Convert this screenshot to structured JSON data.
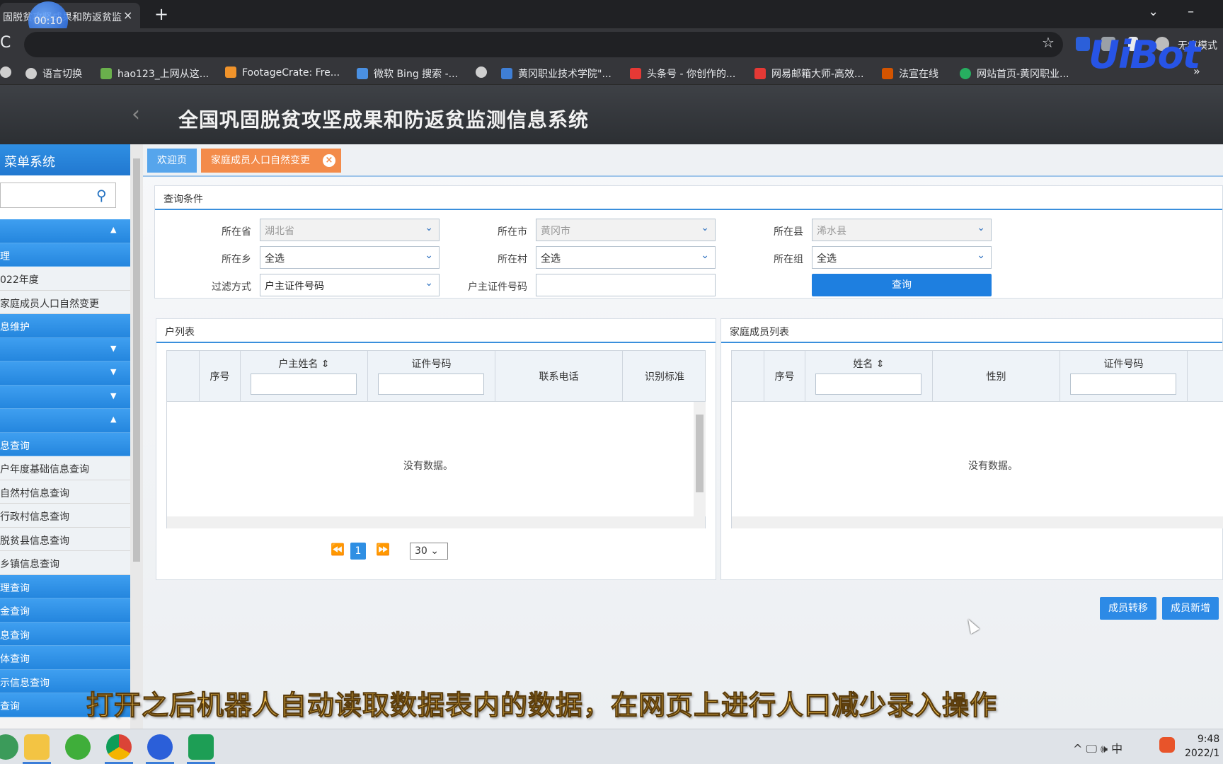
{
  "browser": {
    "tab_title": "固脱贫攻坚成果和防返贫监",
    "recording_time": "00:10",
    "tab_close": "×",
    "new_tab": "+",
    "reload": "C",
    "star": "☆",
    "profile_label": "无痕模式",
    "minimize": "–",
    "dropdown": "⌄",
    "logo_text": "UiBot",
    "bookmarks": [
      {
        "label": "语言切换",
        "color": "#cfcfcf"
      },
      {
        "label": "hao123_上网从这...",
        "color": "#6ab04c"
      },
      {
        "label": "FootageCrate: Fre...",
        "color": "#f0932b"
      },
      {
        "label": "微软 Bing 搜索 -...",
        "color": "#4a90e2"
      },
      {
        "label": "",
        "color": "#cfcfcf"
      },
      {
        "label": "黄冈职业技术学院\"...",
        "color": "#3f7fd6"
      },
      {
        "label": "头条号 - 你创作的...",
        "color": "#e53935"
      },
      {
        "label": "网易邮箱大师-高效...",
        "color": "#e53935"
      },
      {
        "label": "法宣在线",
        "color": "#d35400"
      },
      {
        "label": "网站首页-黄冈职业...",
        "color": "#27ae60"
      }
    ],
    "bookmarks_more": "»"
  },
  "app": {
    "title": "全国巩固脱贫攻坚成果和防返贫监测信息系统",
    "back": "‹"
  },
  "sidebar": {
    "title": "菜单系统",
    "search_icon": "⚲",
    "rows": [
      {
        "label": "",
        "style": "blue",
        "arrow": "▲"
      },
      {
        "label": "理",
        "style": "blue",
        "arrow": ""
      },
      {
        "label": "022年度",
        "style": "light",
        "arrow": ""
      },
      {
        "label": "家庭成员人口自然变更",
        "style": "light",
        "arrow": ""
      },
      {
        "label": "息维护",
        "style": "blue",
        "arrow": ""
      },
      {
        "label": "",
        "style": "blue",
        "arrow": "▼"
      },
      {
        "label": "",
        "style": "blue",
        "arrow": "▼"
      },
      {
        "label": "",
        "style": "blue",
        "arrow": "▼"
      },
      {
        "label": "",
        "style": "blue",
        "arrow": "▲"
      },
      {
        "label": "息查询",
        "style": "blue",
        "arrow": ""
      },
      {
        "label": "户年度基础信息查询",
        "style": "light",
        "arrow": ""
      },
      {
        "label": "自然村信息查询",
        "style": "light",
        "arrow": ""
      },
      {
        "label": "行政村信息查询",
        "style": "light",
        "arrow": ""
      },
      {
        "label": "脱贫县信息查询",
        "style": "light",
        "arrow": ""
      },
      {
        "label": "乡镇信息查询",
        "style": "light",
        "arrow": ""
      },
      {
        "label": "理查询",
        "style": "blue",
        "arrow": ""
      },
      {
        "label": "金查询",
        "style": "blue",
        "arrow": ""
      },
      {
        "label": "息查询",
        "style": "blue",
        "arrow": ""
      },
      {
        "label": "体查询",
        "style": "blue",
        "arrow": ""
      },
      {
        "label": "示信息查询",
        "style": "blue",
        "arrow": ""
      },
      {
        "label": "查询",
        "style": "blue",
        "arrow": ""
      }
    ]
  },
  "tabs": {
    "welcome": "欢迎页",
    "active": "家庭成员人口自然变更",
    "close": "×"
  },
  "query": {
    "title": "查询条件",
    "province_label": "所在省",
    "province_value": "湖北省",
    "city_label": "所在市",
    "city_value": "黄冈市",
    "county_label": "所在县",
    "county_value": "浠水县",
    "township_label": "所在乡",
    "township_value": "全选",
    "village_label": "所在村",
    "village_value": "全选",
    "group_label": "所在组",
    "group_value": "全选",
    "filter_label": "过滤方式",
    "filter_value": "户主证件号码",
    "id_label": "户主证件号码",
    "id_value": "",
    "search_button": "查询",
    "caret": "⌄"
  },
  "household_table": {
    "title": "户列表",
    "columns": [
      "序号",
      "户主姓名 ⇕",
      "证件号码",
      "联系电话",
      "识别标准"
    ],
    "empty_text": "没有数据。",
    "pager": {
      "prev": "⏪",
      "next": "⏩",
      "page": "1",
      "page_size": "30 ⌄"
    }
  },
  "member_table": {
    "title": "家庭成员列表",
    "columns": [
      "序号",
      "姓名 ⇕",
      "性别",
      "证件号码"
    ],
    "empty_text": "没有数据。"
  },
  "actions": {
    "transfer": "成员转移",
    "add": "成员新增"
  },
  "caption": "打开之后机器人自动读取数据表内的数据，在网页上进行人口减少录入操作",
  "taskbar": {
    "tray_icons": "^  🖵  🕪  中",
    "time": "9:48",
    "date": "2022/1"
  }
}
